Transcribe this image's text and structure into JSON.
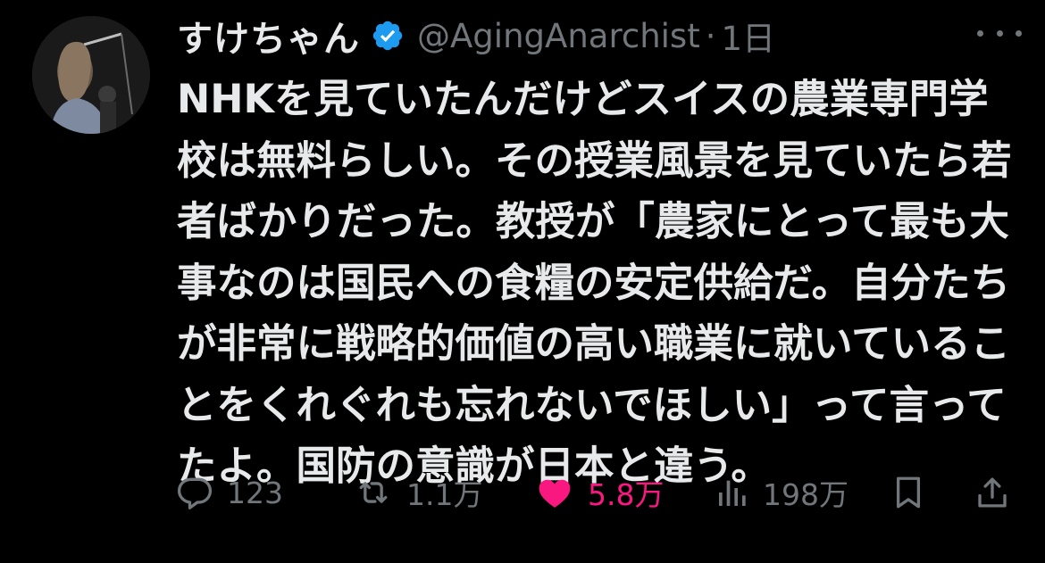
{
  "tweet": {
    "display_name": "すけちゃん",
    "handle": "@AgingAnarchist",
    "separator": "·",
    "time": "1日",
    "body_lines": [
      "NHKを見ていたんだけどスイスの農業専門学",
      "校は無料らしい。その授業風景を見ていたら若",
      "者ばかりだった。教授が「農家にとって最も大",
      "事なのは国民への食糧の安定供給だ。自分たち",
      "が非常に戦略的価値の高い職業に就いているこ",
      "とをくれぐれも忘れないでほしい」って言って",
      "たよ。国防の意識が日本と違う。"
    ]
  },
  "actions": {
    "reply_count": "123",
    "retweet_count": "1.1万",
    "like_count": "5.8万",
    "view_count": "198万"
  },
  "icons": {
    "verified": "verified-badge-icon",
    "more": "more-options-icon",
    "reply": "reply-icon",
    "retweet": "retweet-icon",
    "like": "heart-icon",
    "views": "views-icon",
    "bookmark": "bookmark-icon",
    "share": "share-icon"
  },
  "colors": {
    "background": "#000000",
    "text": "#e7e9ea",
    "muted": "#71767b",
    "verified_blue": "#1d9bf0",
    "like_pink": "#f91880"
  }
}
